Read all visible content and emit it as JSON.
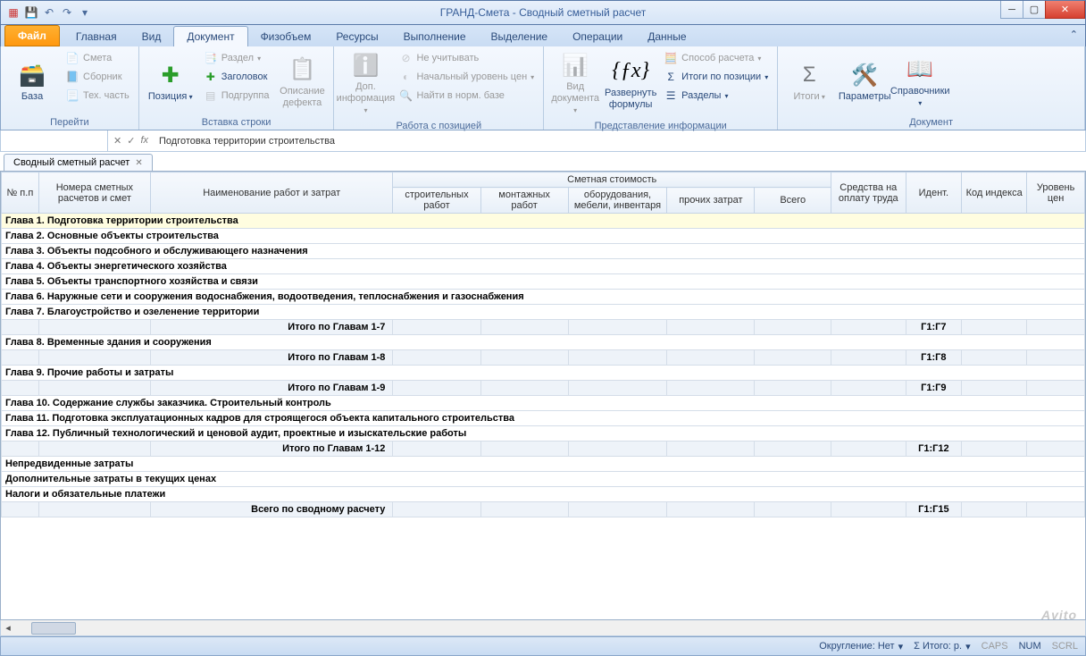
{
  "window": {
    "title": "ГРАНД-Смета - Сводный сметный расчет"
  },
  "tabs": {
    "file": "Файл",
    "items": [
      "Главная",
      "Вид",
      "Документ",
      "Физобъем",
      "Ресурсы",
      "Выполнение",
      "Выделение",
      "Операции",
      "Данные"
    ],
    "active_index": 2
  },
  "ribbon": {
    "g1": {
      "title": "Перейти",
      "base": "База",
      "smeta": "Смета",
      "sbornik": "Сборник",
      "tech": "Тех. часть"
    },
    "g2": {
      "title": "Вставка строки",
      "position": "Позиция",
      "razdel": "Раздел",
      "zagolovok": "Заголовок",
      "podgruppa": "Подгруппа",
      "defect": "Описание дефекта"
    },
    "g3": {
      "title": "Работа с позицией",
      "dopinfo": "Доп. информация",
      "neuchit": "Не учитывать",
      "nachur": "Начальный уровень цен",
      "naiti": "Найти в норм. базе"
    },
    "g4": {
      "title": "Представление информации",
      "viddoc": "Вид документа",
      "razv": "Развернуть формулы",
      "sposob": "Способ расчета",
      "itogipoz": "Итоги по позиции",
      "razdely": "Разделы"
    },
    "g5": {
      "title": "Документ",
      "itogi": "Итоги",
      "params": "Параметры",
      "sprav": "Справочники"
    }
  },
  "formula": {
    "value": "Подготовка территории строительства",
    "fx": "fx"
  },
  "sheet_tab": "Сводный сметный расчет",
  "headers": {
    "num": "№ п.п",
    "nomera": "Номера сметных расчетов и смет",
    "naim": "Наименование работ и затрат",
    "smetn": "Сметная стоимость",
    "stroit": "строительных работ",
    "montazh": "монтажных работ",
    "oborud": "оборудования, мебели, инвентаря",
    "prochih": "прочих затрат",
    "vsego": "Всего",
    "sredstva": "Средства на оплату труда",
    "ident": "Идент.",
    "kod": "Код индекса",
    "uroven": "Уровень цен"
  },
  "rows": [
    {
      "type": "chapter",
      "selected": true,
      "name": "Глава 1. Подготовка территории строительства"
    },
    {
      "type": "chapter",
      "name": "Глава 2. Основные объекты строительства"
    },
    {
      "type": "chapter",
      "name": "Глава 3. Объекты подсобного и обслуживающего назначения"
    },
    {
      "type": "chapter",
      "name": "Глава 4. Объекты энергетического хозяйства"
    },
    {
      "type": "chapter",
      "name": "Глава 5. Объекты транспортного хозяйства и связи"
    },
    {
      "type": "chapter",
      "name": "Глава 6. Наружные сети и сооружения водоснабжения, водоотведения, теплоснабжения и газоснабжения"
    },
    {
      "type": "chapter",
      "name": "Глава 7. Благоустройство и озеленение территории"
    },
    {
      "type": "total",
      "name": "Итого по Главам 1-7",
      "ident": "Г1:Г7"
    },
    {
      "type": "chapter",
      "name": "Глава 8. Временные здания и сооружения"
    },
    {
      "type": "total",
      "name": "Итого по Главам 1-8",
      "ident": "Г1:Г8"
    },
    {
      "type": "chapter",
      "name": "Глава 9. Прочие работы и затраты"
    },
    {
      "type": "total",
      "name": "Итого по Главам 1-9",
      "ident": "Г1:Г9"
    },
    {
      "type": "chapter",
      "name": "Глава 10. Содержание службы заказчика. Строительный контроль"
    },
    {
      "type": "chapter",
      "name": "Глава 11. Подготовка эксплуатационных кадров для строящегося объекта капитального строительства"
    },
    {
      "type": "chapter",
      "name": "Глава 12. Публичный технологический и ценовой аудит, проектные и изыскательские работы"
    },
    {
      "type": "total",
      "name": "Итого по Главам 1-12",
      "ident": "Г1:Г12"
    },
    {
      "type": "chapter",
      "name": "Непредвиденные затраты"
    },
    {
      "type": "chapter",
      "name": "Дополнительные затраты в текущих ценах"
    },
    {
      "type": "chapter",
      "name": "Налоги и обязательные платежи"
    },
    {
      "type": "total",
      "name": "Всего по сводному расчету",
      "ident": "Г1:Г15"
    }
  ],
  "status": {
    "okrug": "Округление: Нет",
    "itogo": "Σ Итого: р.",
    "caps": "CAPS",
    "num": "NUM",
    "scrl": "SCRL"
  },
  "watermark": "Avito"
}
